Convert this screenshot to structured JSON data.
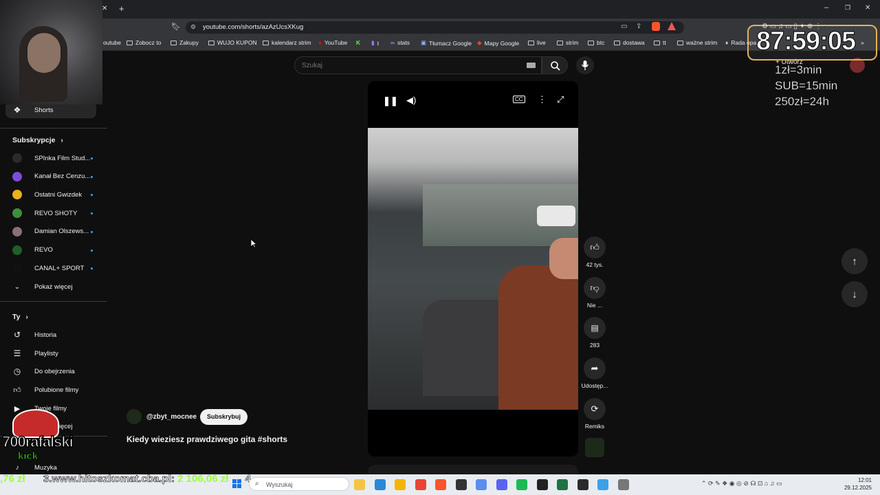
{
  "browser": {
    "url": "youtube.com/shorts/azAzUcsXKug",
    "bookmarks": [
      "outube",
      "Zobocz to",
      "Zakupy",
      "WUJO KUPON",
      "kalendarz strim",
      "YouTube",
      "t",
      "stats",
      "Tłumacz Google",
      "Mapy Google",
      "live",
      "strim",
      "btc",
      "dostawa",
      "tt",
      "ważne strim",
      "Rada opa"
    ]
  },
  "search": {
    "placeholder": "Szukaj"
  },
  "header": {
    "create_label": "Utwórz"
  },
  "sidebar": {
    "shorts_label": "Shorts",
    "subscriptions_title": "Subskrypcje",
    "channels": [
      {
        "name": "SPInka Film Stud...",
        "color": "#2b2b2b"
      },
      {
        "name": "Kanał Bez Cenzu...",
        "color": "#7b4dd6"
      },
      {
        "name": "Ostatni Gwizdek",
        "color": "#e8b21a"
      },
      {
        "name": "REVO SHOTY",
        "color": "#3e8e3e"
      },
      {
        "name": "Damian Olszews...",
        "color": "#8a6f7a"
      },
      {
        "name": "REVO",
        "color": "#1f5f2a"
      },
      {
        "name": "CANAL+ SPORT",
        "color": "#111111"
      }
    ],
    "show_more": "Pokaż więcej",
    "you_title": "Ty",
    "you_items": [
      "Historia",
      "Playlisty",
      "Do obejrzenia",
      "Polubione filmy",
      "Twoje filmy",
      "Pokaż więcej"
    ],
    "music_label": "Muzyka"
  },
  "short": {
    "channel": "@zbyt_mocnee",
    "subscribe_label": "Subskrybuj",
    "title": "Kiedy wieziesz prawdziwego gita #shorts",
    "likes": "42 tys.",
    "dislike": "Nie ...",
    "comments": "283",
    "share": "Udostęp...",
    "remix": "Remiks"
  },
  "overlay": {
    "timer": "87:59:05",
    "rates": [
      "1zł=3min",
      "SUB=15min",
      "250zł=24h"
    ],
    "streamer_logo": "700rafalski",
    "kick_logo": "kick",
    "ticker_left": ",76 zł",
    "ticker_text": "3.www.hitoszkomat.cba.pl:",
    "ticker_amount": "2 106,06 zł",
    "ticker_next": "4"
  },
  "taskbar": {
    "search_placeholder": "Wyszukaj",
    "time": "12:01",
    "date": "29.12.2025"
  },
  "colors": {
    "accent": "#3ea6ff",
    "timer_border": "#e3b458",
    "ticker_green": "#9bff3a"
  }
}
